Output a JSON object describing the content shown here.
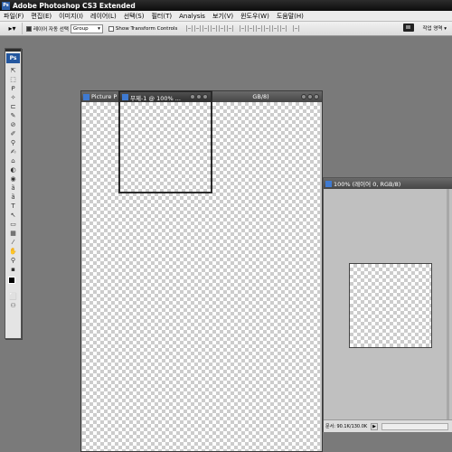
{
  "app": {
    "title": "Adobe Photoshop CS3 Extended",
    "icon": "ps-icon"
  },
  "menu": [
    "파일(F)",
    "편집(E)",
    "이미지(I)",
    "레이어(L)",
    "선택(S)",
    "필터(T)",
    "Analysis",
    "보기(V)",
    "윈도우(W)",
    "도움말(H)"
  ],
  "options": {
    "auto_select_label": "레이어 자동 선택",
    "auto_select_value": "Group",
    "show_transform_label": "Show Transform Controls",
    "workspace_label": "작업 영역 ▾"
  },
  "toolbox": {
    "logo": "Ps",
    "tools": [
      "⇱",
      "⬚",
      "ᑭ",
      "✧",
      "⊏",
      "✎",
      "⊘",
      "✐",
      "⚲",
      "✍",
      "⌂",
      "◐",
      "◉",
      "ȁ",
      "T",
      "↖",
      "▭",
      "▦",
      "⁄",
      "✋",
      "⚲",
      "▪",
      "⬜",
      "⚇"
    ]
  },
  "documents": {
    "picture": {
      "title": "Picture P"
    },
    "untitled": {
      "title": "무제-1 @ 100% ..."
    },
    "untitled_suffix": "GB/8)",
    "right": {
      "title": "100% (레이어 0, RGB/8)",
      "status": "문서: 90.1K/130.0K"
    }
  },
  "colors": {
    "titlebar": "#0c0c0c",
    "background": "#7a7a7a",
    "checker": "#cccccc"
  }
}
